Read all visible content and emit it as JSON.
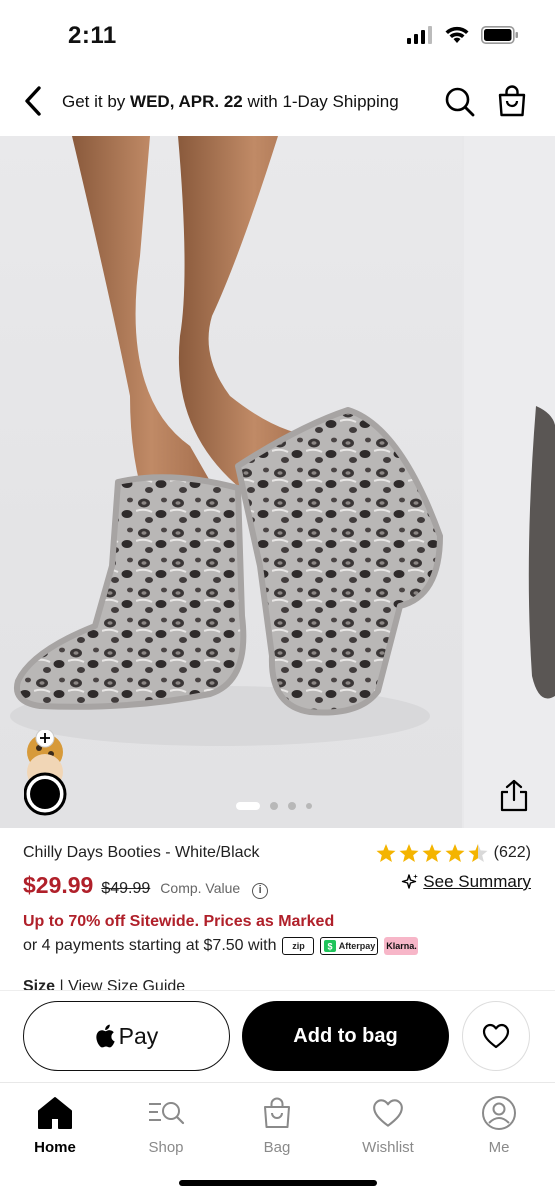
{
  "status": {
    "time": "2:11"
  },
  "header": {
    "ship_prefix": "Get it by ",
    "ship_date": "WED, APR. 22",
    "ship_suffix": " with 1-Day Shipping"
  },
  "product": {
    "title": "Chilly Days Booties - White/Black",
    "rating": {
      "stars": 4.5,
      "max": 5,
      "count": "(622)"
    },
    "price": "$29.99",
    "price_old": "$49.99",
    "comp_value": "Comp. Value",
    "see_summary": "See Summary",
    "promo": "Up to 70% off Sitewide. Prices as Marked",
    "payments_text": "or 4 payments starting at $7.50 with",
    "payment_badges": [
      "zip",
      "Afterpay",
      "Klarna."
    ],
    "size_label": "Size",
    "size_guide": "View Size Guide"
  },
  "gallery": {
    "dot_count": 3,
    "active_dot": 1
  },
  "actions": {
    "apple_pay": "Pay",
    "add_to_bag": "Add to bag"
  },
  "tabs": [
    {
      "label": "Home",
      "icon": "home-icon",
      "active": true
    },
    {
      "label": "Shop",
      "icon": "shop-icon",
      "active": false
    },
    {
      "label": "Bag",
      "icon": "bag-icon",
      "active": false
    },
    {
      "label": "Wishlist",
      "icon": "heart-icon",
      "active": false
    },
    {
      "label": "Me",
      "icon": "profile-icon",
      "active": false
    }
  ],
  "colors": {
    "accent_red": "#b0202a",
    "star_gold": "#f4b400",
    "klarna_pink": "#f7b6c8"
  }
}
